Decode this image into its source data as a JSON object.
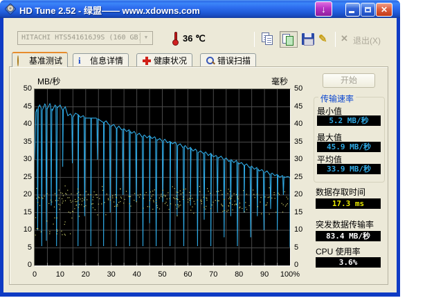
{
  "window": {
    "title": "HD Tune 2.52 - 绿盟—— www.xdowns.com"
  },
  "icons": {
    "download_arrow": "↓",
    "close_glyph": "x",
    "combo_chevron": "▼",
    "exit_x": "✕",
    "brush": "✎",
    "info_i": "i"
  },
  "toolbar": {
    "drive_select": "HITACHI HTS541616J9S (160 GB)",
    "temperature": "36 ℃",
    "exit_label": "退出(X)"
  },
  "tabs": [
    {
      "label": "基准测试"
    },
    {
      "label": "信息详情"
    },
    {
      "label": "健康状况"
    },
    {
      "label": "错误扫描"
    }
  ],
  "results": {
    "start_button": "开始",
    "transfer_group_title": "传输速率",
    "min_label": "最小值",
    "min_value": "5.2 MB/秒",
    "max_label": "最大值",
    "max_value": "45.9 MB/秒",
    "avg_label": "平均值",
    "avg_value": "33.9 MB/秒",
    "access_label": "数据存取时间",
    "access_value": "17.3 ms",
    "burst_label": "突发数据传输率",
    "burst_value": "83.4 MB/秒",
    "cpu_label": "CPU 使用率",
    "cpu_value": "3.6%"
  },
  "chart_data": {
    "type": "line",
    "title": "",
    "left_axis": {
      "label": "MB/秒",
      "min": 0,
      "max": 50,
      "tick_step": 5,
      "ticks": [
        "50",
        "45",
        "40",
        "35",
        "30",
        "25",
        "20",
        "15",
        "10",
        "5",
        "0"
      ]
    },
    "right_axis": {
      "label": "毫秒",
      "min": 0,
      "max": 50,
      "tick_step": 5,
      "ticks": [
        "50",
        "45",
        "40",
        "35",
        "30",
        "25",
        "20",
        "15",
        "10",
        "5",
        "0"
      ]
    },
    "x_axis": {
      "min": 0,
      "max": 100,
      "tick_step": 10,
      "labels": [
        "0",
        "10",
        "20",
        "30",
        "40",
        "50",
        "60",
        "70",
        "80",
        "90",
        "100%"
      ]
    },
    "grid": {
      "color": "#4a4a4a",
      "bg": "#000000",
      "tick_color": "#9a9a9a"
    },
    "series": [
      {
        "name": "transfer_rate_mbps",
        "color": "#2fa9e4",
        "envelope": [
          [
            0,
            30
          ],
          [
            0.5,
            43.5
          ],
          [
            1,
            44.5
          ],
          [
            2,
            45.5
          ],
          [
            3,
            44
          ],
          [
            4,
            45.8
          ],
          [
            5,
            44.5
          ],
          [
            6,
            45.9
          ],
          [
            7,
            44
          ],
          [
            8,
            45.5
          ],
          [
            9,
            44.8
          ],
          [
            10,
            45.5
          ],
          [
            11,
            44
          ],
          [
            12,
            45
          ],
          [
            13,
            42.5
          ],
          [
            14,
            43
          ],
          [
            15,
            42
          ],
          [
            16,
            43.2
          ],
          [
            17,
            42.8
          ],
          [
            18,
            42
          ],
          [
            19,
            42.5
          ],
          [
            20,
            41.8
          ],
          [
            22,
            41.8
          ],
          [
            24,
            41.8
          ],
          [
            25,
            41.5
          ],
          [
            26,
            41
          ],
          [
            27,
            40.5
          ],
          [
            28,
            41
          ],
          [
            29,
            40
          ],
          [
            30,
            39.5
          ],
          [
            31,
            40
          ],
          [
            32,
            38.8
          ],
          [
            33,
            39.5
          ],
          [
            34,
            38.5
          ],
          [
            35,
            38.8
          ],
          [
            36,
            38
          ],
          [
            37,
            38.5
          ],
          [
            38,
            37.5
          ],
          [
            39,
            38
          ],
          [
            40,
            37
          ],
          [
            41,
            37.5
          ],
          [
            42,
            36.5
          ],
          [
            43,
            37
          ],
          [
            44,
            36.2
          ],
          [
            45,
            36.8
          ],
          [
            46,
            36
          ],
          [
            47,
            36.5
          ],
          [
            48,
            35.5
          ],
          [
            49,
            36
          ],
          [
            50,
            35.2
          ],
          [
            51,
            35.8
          ],
          [
            52,
            34.8
          ],
          [
            53,
            35.2
          ],
          [
            54,
            34.5
          ],
          [
            55,
            35
          ],
          [
            56,
            34
          ],
          [
            57,
            34.5
          ],
          [
            58,
            33.5
          ],
          [
            59,
            34
          ],
          [
            60,
            33
          ],
          [
            61,
            33.5
          ],
          [
            62,
            32.5
          ],
          [
            63,
            33
          ],
          [
            64,
            32
          ],
          [
            65,
            32.5
          ],
          [
            66,
            31.8
          ],
          [
            67,
            32.2
          ],
          [
            68,
            31.2
          ],
          [
            69,
            31.8
          ],
          [
            70,
            30.8
          ],
          [
            71,
            31.2
          ],
          [
            72,
            30.5
          ],
          [
            73,
            31
          ],
          [
            74,
            30
          ],
          [
            75,
            30.5
          ],
          [
            76,
            29.5
          ],
          [
            77,
            30
          ],
          [
            78,
            29.2
          ],
          [
            79,
            29.8
          ],
          [
            80,
            28.8
          ],
          [
            81,
            29.2
          ],
          [
            82,
            28.3
          ],
          [
            83,
            28.8
          ],
          [
            84,
            27.8
          ],
          [
            85,
            28.2
          ],
          [
            86,
            27.3
          ],
          [
            87,
            27.8
          ],
          [
            88,
            26.8
          ],
          [
            89,
            27.2
          ],
          [
            90,
            26.3
          ],
          [
            91,
            26.8
          ],
          [
            92,
            25.8
          ],
          [
            93,
            26.2
          ],
          [
            94,
            25.5
          ],
          [
            95,
            25.8
          ],
          [
            96,
            25
          ],
          [
            97,
            25.5
          ],
          [
            98,
            25
          ],
          [
            99,
            25.2
          ],
          [
            100,
            25
          ]
        ],
        "spikes": [
          [
            1.2,
            10
          ],
          [
            2.8,
            5.5
          ],
          [
            4.6,
            7
          ],
          [
            6.5,
            17
          ],
          [
            8.6,
            5.5
          ],
          [
            11,
            28
          ],
          [
            14.8,
            29
          ],
          [
            17,
            5.5
          ],
          [
            19.6,
            14
          ],
          [
            22,
            5.5
          ],
          [
            24.6,
            30
          ],
          [
            27,
            5.5
          ],
          [
            29.6,
            15
          ],
          [
            32,
            5.5
          ],
          [
            34.6,
            20
          ],
          [
            37.2,
            5.5
          ],
          [
            39.8,
            18
          ],
          [
            42.4,
            5.5
          ],
          [
            45,
            12
          ],
          [
            47.6,
            5.5
          ],
          [
            50.2,
            18
          ],
          [
            53,
            5.5
          ],
          [
            55.8,
            14
          ],
          [
            58.4,
            5.5
          ],
          [
            61,
            17
          ],
          [
            63.8,
            5.5
          ],
          [
            66.4,
            13
          ],
          [
            69,
            5.5
          ],
          [
            71.6,
            15
          ],
          [
            74.2,
            8
          ],
          [
            76.8,
            14
          ],
          [
            79.4,
            5.5
          ],
          [
            82,
            15
          ],
          [
            84.6,
            8
          ],
          [
            87.2,
            14
          ],
          [
            89.8,
            10
          ],
          [
            92.4,
            16
          ],
          [
            95,
            10
          ],
          [
            97.4,
            20
          ],
          [
            100,
            5.2
          ]
        ]
      },
      {
        "name": "access_time_ms",
        "color": "#cccf6e",
        "scatter_band": {
          "count": 300,
          "x_min": 0.5,
          "x_max": 99,
          "y_mean": 18.5,
          "y_spread": 3.4,
          "y_min": 12,
          "y_max": 25,
          "seed": 7
        },
        "low_outliers": {
          "count": 22,
          "x_max": 16,
          "y_min": 8,
          "y_max": 14
        }
      }
    ],
    "stats": {
      "min_mbps": 5.2,
      "max_mbps": 45.9,
      "avg_mbps": 33.9,
      "access_ms": 17.3,
      "burst_mbps": 83.4,
      "cpu_pct": 3.6
    }
  }
}
